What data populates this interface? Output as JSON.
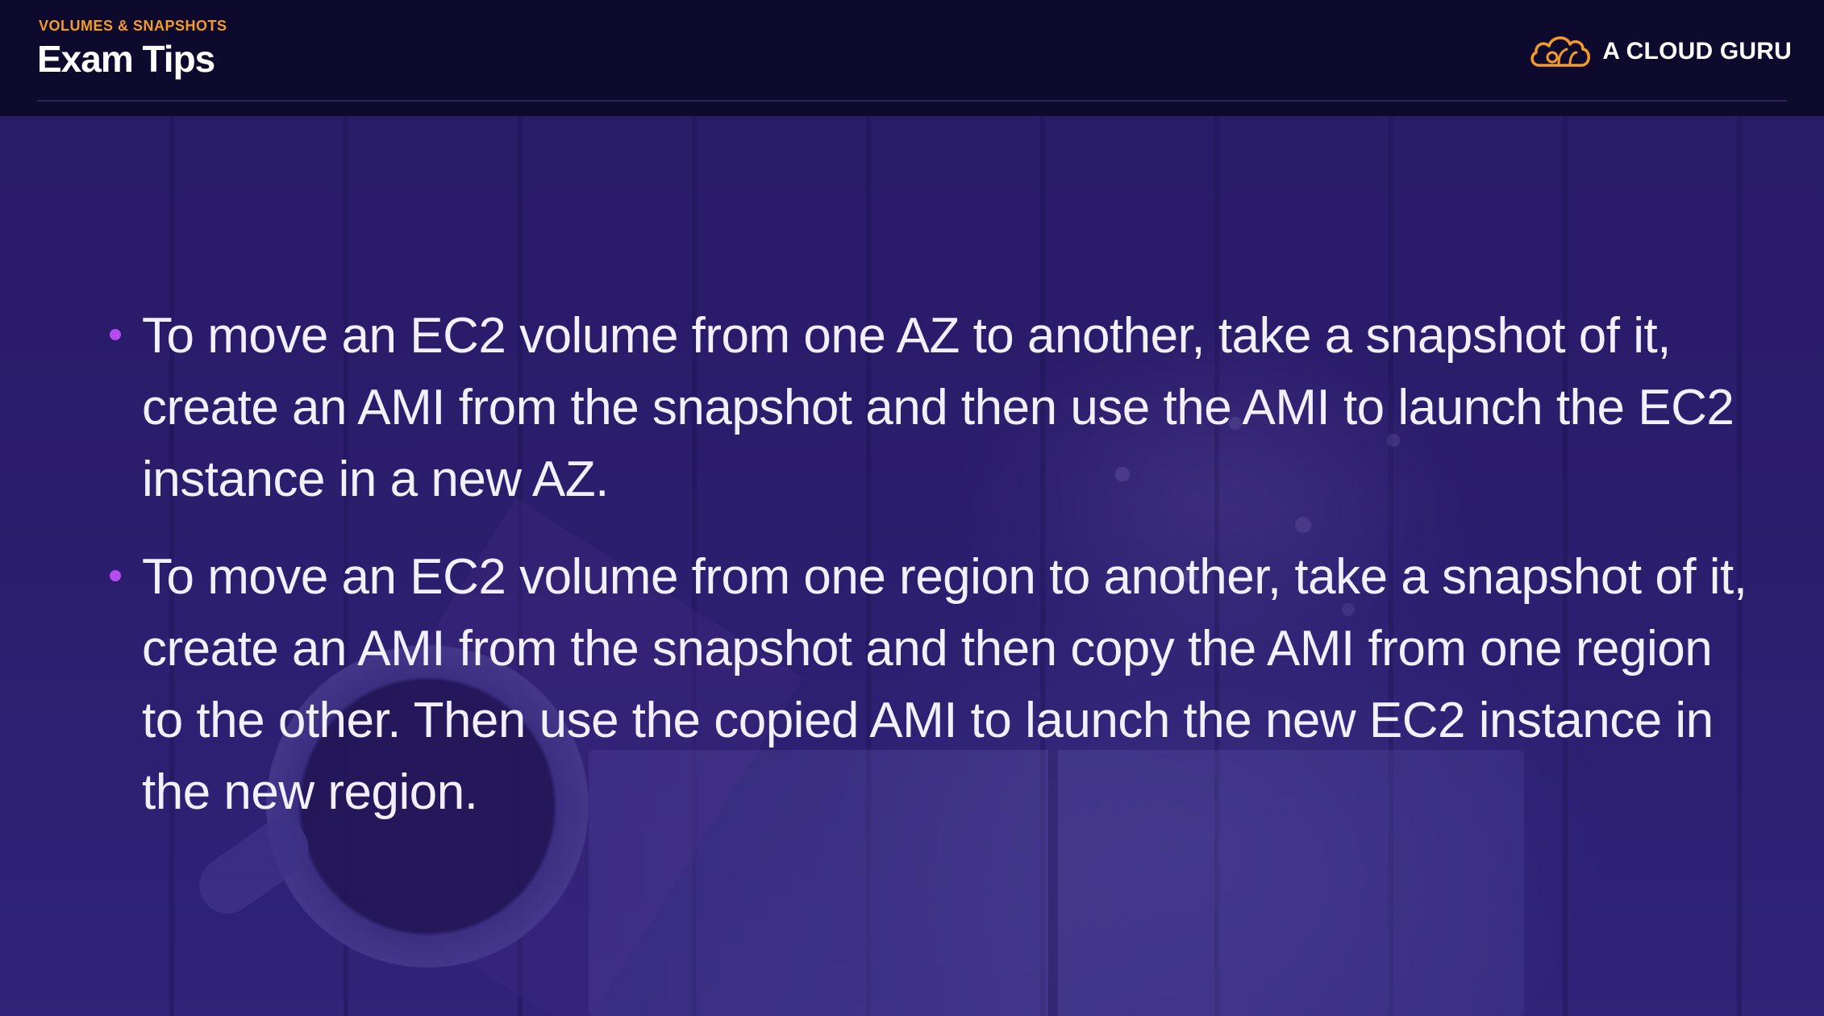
{
  "header": {
    "kicker": "VOLUMES & SNAPSHOTS",
    "title": "Exam Tips",
    "brand_name": "A CLOUD GURU",
    "brand_icon": "cloud-logo-icon"
  },
  "colors": {
    "kicker": "#f59a2d",
    "header_bg": "#0d0a2e",
    "bullet_dot": "#b44cf0",
    "text": "#f2efff"
  },
  "bullets": [
    "To move an EC2 volume from one AZ to another, take a snapshot of it, create an AMI from the snapshot and then use the AMI to launch the EC2 instance in a new AZ.",
    "To move an EC2 volume from one region to another, take a snapshot of it, create an AMI from the snapshot and then copy the AMI from one region to the other. Then use the copied AMI to launch the new EC2 instance in the new region."
  ]
}
